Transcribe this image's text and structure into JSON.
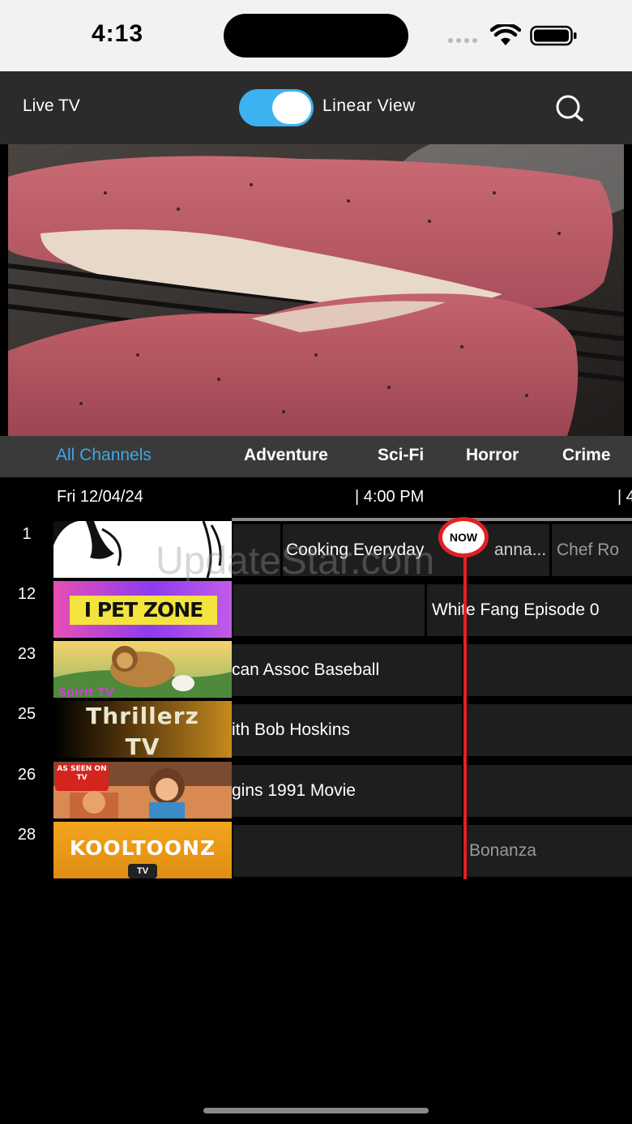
{
  "status_bar": {
    "time": "4:13"
  },
  "nav": {
    "title": "Live TV",
    "toggle_label": "Linear View",
    "toggle_on": true
  },
  "categories": [
    "All Channels",
    "Adventure",
    "Sci-Fi",
    "Horror",
    "Crime"
  ],
  "guide": {
    "date": "Fri 12/04/24",
    "times": [
      "| 4:00 PM",
      "| 4"
    ],
    "now_label": "NOW",
    "rows": [
      {
        "channel": "1",
        "programs": [
          "",
          "Cooking Everyday",
          "anna...",
          "Chef Ro"
        ]
      },
      {
        "channel": "12",
        "logo_text": "I PET ZONE",
        "programs": [
          "",
          "White Fang Episode 0"
        ]
      },
      {
        "channel": "23",
        "logo_text": "Spirit TV",
        "programs": [
          "can Assoc Baseball",
          ""
        ]
      },
      {
        "channel": "25",
        "logo_text": "Thrillerz TV",
        "programs": [
          "ith Bob Hoskins",
          ""
        ]
      },
      {
        "channel": "26",
        "logo_text": "AS SEEN ON TV",
        "programs": [
          "gins 1991 Movie",
          ""
        ]
      },
      {
        "channel": "28",
        "logo_text": "KOOLTOONZ",
        "logo_sub": "TV",
        "programs": [
          "",
          "Bonanza"
        ]
      }
    ]
  },
  "watermark": "UpdateStar.com",
  "colors": {
    "accent": "#3ea6e6",
    "now_line": "#e31f26",
    "toggle": "#3cb2f0"
  }
}
